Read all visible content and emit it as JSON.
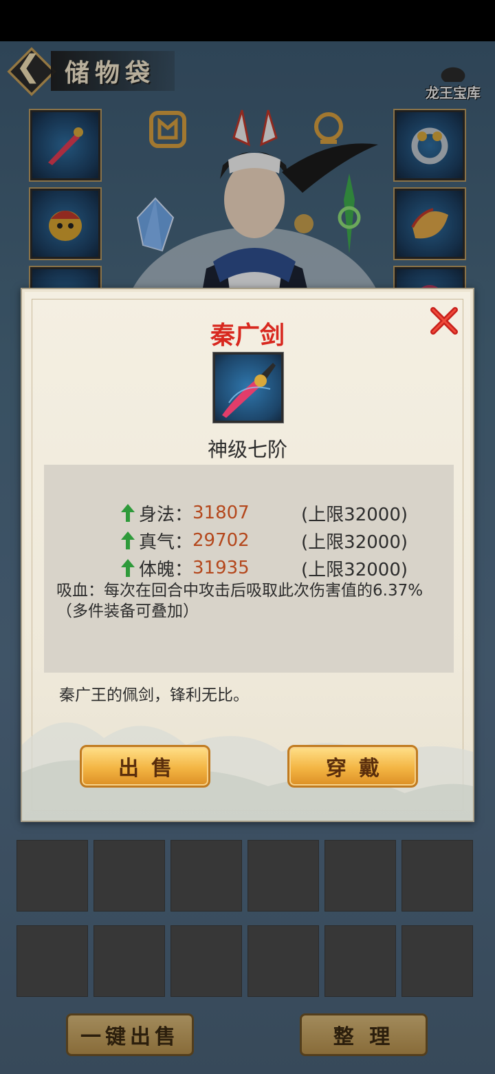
{
  "header": {
    "title": "储物袋",
    "logo_text": "龙王宝库"
  },
  "equipment_slots": {
    "left": [
      "sword-icon",
      "lion-helmet-icon",
      "mask-icon"
    ],
    "center": [
      "armor-rune-icon",
      "ring-rune-icon"
    ],
    "right": [
      "ring-icon",
      "jade-amulet-icon",
      "orb-icon"
    ],
    "floating": [
      "crystal-icon",
      "green-pendant-icon"
    ]
  },
  "inventory": {
    "rows": 2,
    "cols": 6,
    "sell_all_label": "一键出售",
    "sort_label": "整 理"
  },
  "popup": {
    "item_name": "秦广剑",
    "grade": "神级七阶",
    "stats": [
      {
        "label": "身法：",
        "value": "31807",
        "cap": "(上限32000)"
      },
      {
        "label": "真气：",
        "value": "29702",
        "cap": "(上限32000)"
      },
      {
        "label": "体魄：",
        "value": "31935",
        "cap": "(上限32000)"
      }
    ],
    "effect": "吸血：每次在回合中攻击后吸取此次伤害值的6.37%（多件装备可叠加）",
    "description": "秦广王的佩剑，锋利无比。",
    "sell_label": "出售",
    "equip_label": "穿戴"
  },
  "colors": {
    "item_name": "#d8281f",
    "stat_value": "#b4471c",
    "up_arrow": "#2e9a3a",
    "button_gold": "#f3b543"
  }
}
